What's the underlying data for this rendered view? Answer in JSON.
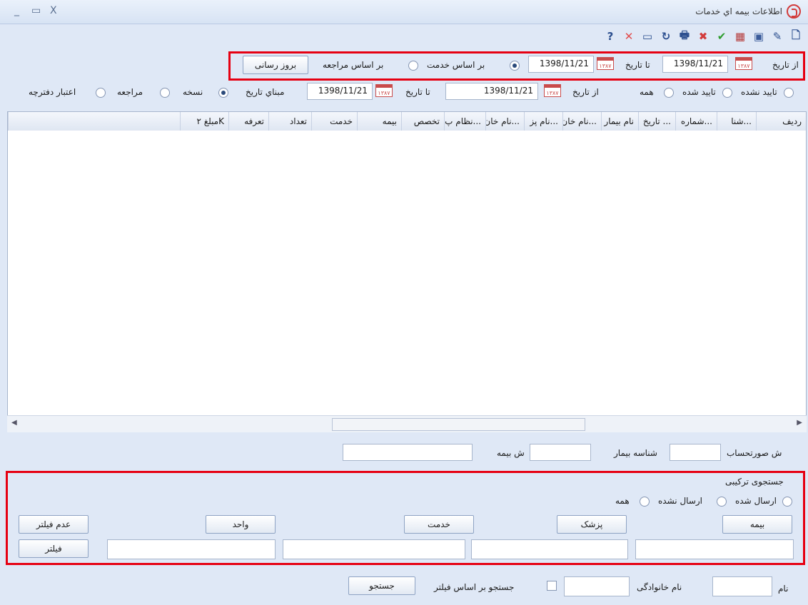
{
  "window": {
    "title": "اطلاعات بیمه اي خدمات",
    "controls": [
      "_",
      "▭",
      "X"
    ]
  },
  "toolbar": {
    "icons": [
      {
        "name": "new-icon",
        "glyph": "🗋",
        "color": "#2c4f8f"
      },
      {
        "name": "edit-icon",
        "glyph": "✎",
        "color": "#2c4f8f"
      },
      {
        "name": "preview-icon",
        "glyph": "▣",
        "color": "#3a5b9a"
      },
      {
        "name": "grid-icon",
        "glyph": "▦",
        "color": "#b53b3b"
      },
      {
        "name": "confirm-icon",
        "glyph": "✔",
        "color": "#2c9c2c"
      },
      {
        "name": "delete-icon",
        "glyph": "✖",
        "color": "#d23b3b"
      },
      {
        "name": "print-icon",
        "glyph": "🖶",
        "color": "#2c4f8f"
      },
      {
        "name": "refresh-icon",
        "glyph": "↻",
        "color": "#2c4f8f"
      },
      {
        "name": "save-icon",
        "glyph": "▭",
        "color": "#2c4f8f"
      },
      {
        "name": "close-icon",
        "glyph": "✕",
        "color": "#e14c4c"
      },
      {
        "name": "help-icon",
        "glyph": "?",
        "color": "#2c4f8f"
      }
    ]
  },
  "filter_top": {
    "from_label": "از تاریخ",
    "from_value": "1398/11/21",
    "to_label": "تا تاریخ",
    "to_value": "1398/11/21",
    "radio_service": "بر اساس خدمت",
    "radio_visit": "بر اساس مراجعه",
    "update_button": "بروز رسانی",
    "cal_text": "۱۳۸۷"
  },
  "filter_second": {
    "radio_unconfirmed": "تایید نشده",
    "radio_confirmed": "تایید شده",
    "radio_all": "همه",
    "from_label": "از تاریخ",
    "from_value": "1398/11/21",
    "to_label": "تا تاریخ",
    "to_value": "1398/11/21",
    "basis_label": "مبناي تاریخ",
    "radio_prescription": "نسخه",
    "radio_visit": "مراجعه",
    "radio_ledger": "اعتبار دفترچه"
  },
  "table": {
    "columns": [
      "ردیف",
      "شنا...",
      "شماره...",
      "تاریخ ...",
      "نام بیمار",
      "نام خان...",
      "نام پز...",
      "نام خان...",
      "نظام پ...",
      "تخصص",
      "بیمه",
      "خدمت",
      "تعداد",
      "تعرفه",
      "مبلغ ۲K"
    ],
    "rows": []
  },
  "fields": {
    "invoice_label": "ش صورتحساب",
    "patient_label": "شناسه بیمار",
    "insurance_label": "ش بیمه"
  },
  "combined_search": {
    "title": "جستجوی ترکیبی",
    "radio_sent": "ارسال شده",
    "radio_not_sent": "ارسال نشده",
    "radio_all": "همه",
    "btn_insurance": "بیمه",
    "btn_doctor": "پزشک",
    "btn_service": "خدمت",
    "btn_unit": "واحد",
    "btn_no_filter": "عدم فیلتر",
    "btn_filter": "فیلتر"
  },
  "bottom": {
    "name_label": "نام",
    "family_label": "نام خانوادگی",
    "filter_check_label": "جستجو بر اساس فیلتر",
    "search_button": "جستجو"
  }
}
